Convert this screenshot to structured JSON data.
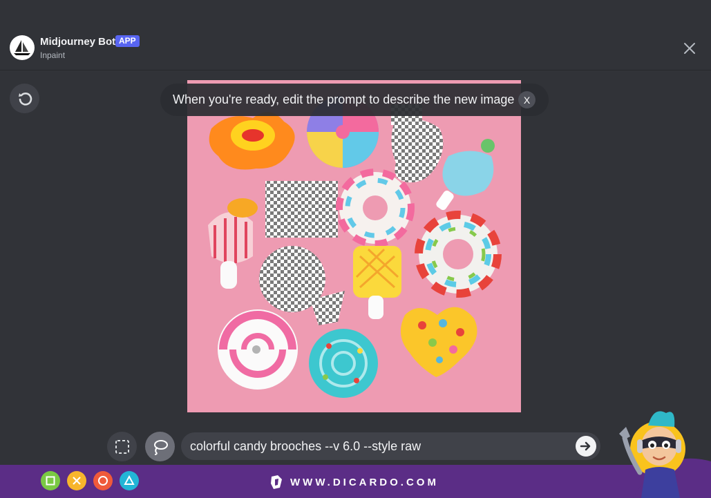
{
  "header": {
    "bot_name": "Midjourney Bot",
    "badge": "APP",
    "subtitle": "Inpaint",
    "avatar_icon": "sailboat-icon",
    "close_icon": "close-icon"
  },
  "toolbar": {
    "undo_icon": "undo-icon"
  },
  "tooltip": {
    "text": "When you're ready, edit the prompt to describe the new image",
    "close_label": "X"
  },
  "tools": {
    "rectangle_icon": "rectangle-select-icon",
    "lasso_icon": "lasso-select-icon",
    "active_tool": "lasso"
  },
  "prompt": {
    "value": "colorful candy brooches --v 6.0 --style raw",
    "submit_icon": "arrow-right-icon"
  },
  "footer": {
    "brand_text": "WWW.DICARDO.COM",
    "shape_icons": [
      "square-icon",
      "cross-icon",
      "circle-icon",
      "triangle-icon"
    ],
    "shape_colors": [
      "#7ac943",
      "#f7b52c",
      "#ef5a3a",
      "#22b5d6"
    ]
  },
  "colors": {
    "background": "#313338",
    "accent": "#5865f2",
    "canvas_pink": "#ee9bb2",
    "footer": "#5b2d86"
  }
}
